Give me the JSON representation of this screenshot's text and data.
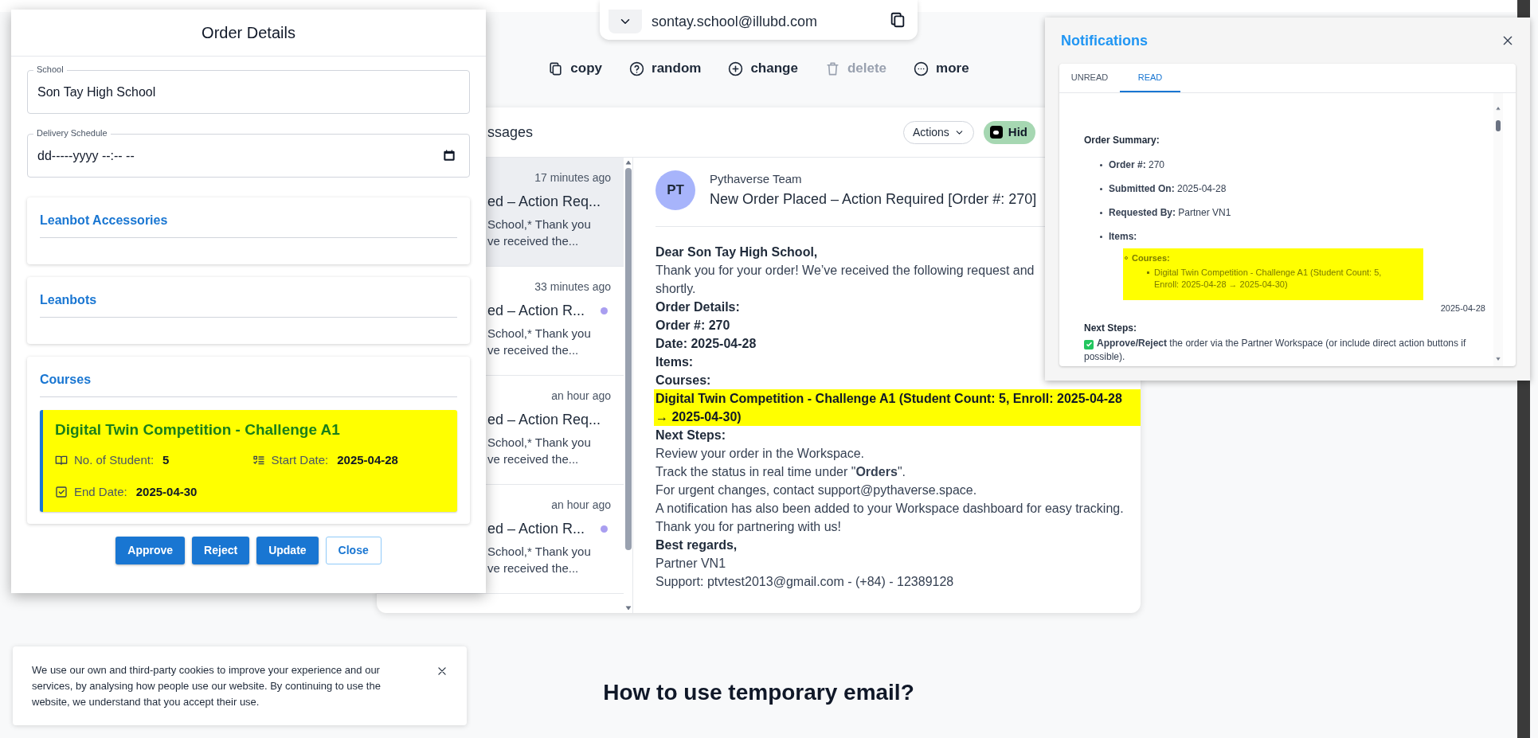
{
  "email_bar": {
    "address": "sontay.school@illubd.com"
  },
  "email_actions": [
    {
      "label": "copy",
      "kind": "copy",
      "disabled": false
    },
    {
      "label": "random",
      "kind": "random",
      "disabled": false
    },
    {
      "label": "change",
      "kind": "change",
      "disabled": false
    },
    {
      "label": "delete",
      "kind": "delete",
      "disabled": true
    },
    {
      "label": "more",
      "kind": "more",
      "disabled": false
    }
  ],
  "inbox": {
    "title": "ssages",
    "actions_button": "Actions",
    "hide_button": "Hid",
    "messages": [
      {
        "time": "17 minutes ago",
        "title": "ed – Action Req...",
        "preview": [
          "School,* Thank you",
          "ve received the..."
        ],
        "unread": false,
        "selected": true
      },
      {
        "time": "33 minutes ago",
        "title": "ed – Action R...",
        "preview": [
          "School,* Thank you",
          "ve received the..."
        ],
        "unread": true,
        "selected": false
      },
      {
        "time": "an hour ago",
        "title": "ed – Action Req...",
        "preview": [
          "School,* Thank you",
          "ve received the..."
        ],
        "unread": false,
        "selected": false
      },
      {
        "time": "an hour ago",
        "title": "ed – Action R...",
        "preview": [
          "School,* Thank you",
          "ve received the..."
        ],
        "unread": true,
        "selected": false
      }
    ]
  },
  "message": {
    "avatar": "PT",
    "sender": "Pythaverse Team",
    "subject": "New Order Placed – Action Required [Order #: 270]",
    "body": [
      {
        "kind": "bold",
        "text": "Dear Son Tay High School,"
      },
      {
        "kind": "text",
        "text": "Thank you for your order! We’ve received the following request and"
      },
      {
        "kind": "text",
        "text": "shortly."
      },
      {
        "kind": "bold",
        "text": "Order Details:"
      },
      {
        "kind": "bold",
        "text": "Order #: 270"
      },
      {
        "kind": "bold",
        "text": "Date: 2025-04-28"
      },
      {
        "kind": "bold",
        "text": "Items:"
      },
      {
        "kind": "bold",
        "text": "Courses:"
      },
      {
        "kind": "highlight",
        "text": "Digital Twin Competition - Challenge A1 (Student Count: 5, Enroll: 2025-04-28 → 2025-04-30)"
      },
      {
        "kind": "bold",
        "text": "Next Steps:"
      },
      {
        "kind": "text",
        "text": "Review your order in the Workspace."
      },
      {
        "kind": "text",
        "text": "Track the status in real time under \"**Orders**\"."
      },
      {
        "kind": "text",
        "text": "For urgent changes, contact support@pythaverse.space."
      },
      {
        "kind": "text",
        "text": "A notification has also been added to your Workspace dashboard for easy tracking."
      },
      {
        "kind": "text",
        "text": "Thank you for partnering with us!"
      },
      {
        "kind": "bold",
        "text": "Best regards,"
      },
      {
        "kind": "text",
        "text": "Partner VN1"
      },
      {
        "kind": "text",
        "text": "Support: ptvtest2013@gmail.com - (+84) - 12389128"
      }
    ]
  },
  "order_dialog": {
    "title": "Order Details",
    "fields": [
      {
        "kind": "text",
        "label": "School",
        "value": "Son Tay High School"
      },
      {
        "kind": "datetime",
        "label": "Delivery Schedule",
        "placeholder": "dd-----yyyy --:-- --"
      }
    ],
    "sections": [
      {
        "title": "Leanbot Accessories"
      },
      {
        "title": "Leanbots"
      },
      {
        "title": "Courses",
        "items": [
          {
            "title": "Digital Twin Competition - Challenge A1",
            "details": [
              {
                "kind": "students",
                "label": "No. of Student:",
                "value": "5"
              },
              {
                "kind": "start",
                "label": "Start Date:",
                "value": "2025-04-28"
              },
              {
                "kind": "end",
                "label": "End Date:",
                "value": "2025-04-30"
              }
            ]
          }
        ]
      }
    ],
    "buttons": [
      {
        "label": "Approve",
        "kind": "primary"
      },
      {
        "label": "Reject",
        "kind": "primary"
      },
      {
        "label": "Update",
        "kind": "primary"
      },
      {
        "label": "Close",
        "kind": "outlined"
      }
    ]
  },
  "notifications": {
    "title": "Notifications",
    "tabs": [
      {
        "label": "UNREAD",
        "selected": false
      },
      {
        "label": "READ",
        "selected": true
      }
    ],
    "summary_heading": "Order Summary:",
    "summary_items": [
      "**Order #:** 270",
      "**Submitted On:** 2025-04-28",
      "**Requested By:** Partner VN1",
      "**Items:**"
    ],
    "courses_heading": "Courses:",
    "courses": [
      "Digital Twin Competition - Challenge A1 (Student Count: 5, Enroll: 2025-04-28 → 2025-04-30)"
    ],
    "date": "2025-04-28",
    "next_steps_heading": "Next Steps:",
    "next_steps": [
      "**Approve/Reject** the order via the Partner Workspace (or include direct action buttons if possible)."
    ]
  },
  "cookie_banner": {
    "text": "We use our own and third-party cookies to improve your experience and our services, by analysing how people use our website. By continuing to use the website, we understand that you accept their use."
  },
  "help_heading": "How to use temporary email?"
}
